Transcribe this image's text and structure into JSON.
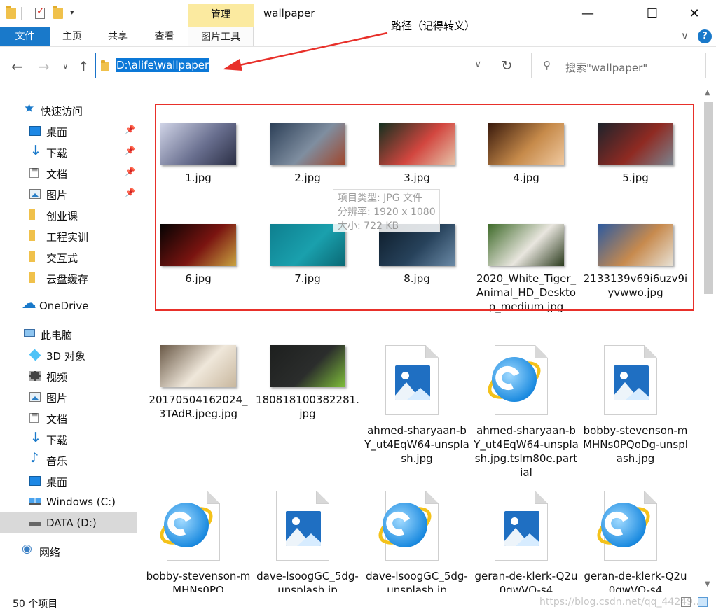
{
  "window": {
    "title": "wallpaper",
    "manage_label": "管理",
    "minimize_glyph": "—",
    "maximize_glyph": "☐",
    "close_glyph": "✕",
    "qa_dropdown_glyph": "▾",
    "accent_color": "#1979ca",
    "manage_color": "#fbeaa0"
  },
  "ribbon": {
    "tabs": [
      {
        "label": "文件"
      },
      {
        "label": "主页"
      },
      {
        "label": "共享"
      },
      {
        "label": "查看"
      },
      {
        "label": "图片工具"
      }
    ],
    "expand_glyph": "∨",
    "help_glyph": "?"
  },
  "annotation": {
    "text": "路径（记得转义）",
    "color": "#e8302a"
  },
  "navigation": {
    "back_glyph": "←",
    "forward_glyph": "→",
    "recent_glyph": "∨",
    "up_glyph": "↑",
    "address": "D:\\alife\\wallpaper",
    "address_dropdown_glyph": "∨",
    "refresh_glyph": "↻",
    "search_placeholder": "搜索\"wallpaper\"",
    "search_glyph": "⚲"
  },
  "sidebar": {
    "items": [
      {
        "label": "快速访问",
        "icon": "star-icon",
        "pinned": false
      },
      {
        "label": "桌面",
        "icon": "desktop-icon",
        "pinned": true
      },
      {
        "label": "下载",
        "icon": "download-icon",
        "pinned": true
      },
      {
        "label": "文档",
        "icon": "document-icon",
        "pinned": true
      },
      {
        "label": "图片",
        "icon": "picture-icon",
        "pinned": true
      },
      {
        "label": "创业课",
        "icon": "folder-icon",
        "pinned": false
      },
      {
        "label": "工程实训",
        "icon": "folder-icon",
        "pinned": false
      },
      {
        "label": "交互式",
        "icon": "folder-icon",
        "pinned": false
      },
      {
        "label": "云盘缓存",
        "icon": "folder-icon",
        "pinned": false
      },
      {
        "label": "OneDrive",
        "icon": "cloud-icon",
        "pinned": false
      },
      {
        "label": "此电脑",
        "icon": "computer-icon",
        "pinned": false
      },
      {
        "label": "3D 对象",
        "icon": "3d-objects-icon",
        "pinned": false
      },
      {
        "label": "视频",
        "icon": "video-icon",
        "pinned": false
      },
      {
        "label": "图片",
        "icon": "picture-icon",
        "pinned": false
      },
      {
        "label": "文档",
        "icon": "document-icon",
        "pinned": false
      },
      {
        "label": "下载",
        "icon": "download-icon",
        "pinned": false
      },
      {
        "label": "音乐",
        "icon": "music-icon",
        "pinned": false
      },
      {
        "label": "桌面",
        "icon": "desktop-icon",
        "pinned": false
      },
      {
        "label": "Windows (C:)",
        "icon": "windows-drive-icon",
        "pinned": false
      },
      {
        "label": "DATA (D:)",
        "icon": "drive-icon",
        "pinned": false,
        "selected": true
      },
      {
        "label": "网络",
        "icon": "network-icon",
        "pinned": false
      }
    ],
    "pin_glyph": "📌"
  },
  "files": [
    {
      "name": "1.jpg",
      "type": "photo",
      "palette": [
        "#cfd3e6",
        "#6a7090",
        "#2b2f45"
      ]
    },
    {
      "name": "2.jpg",
      "type": "photo",
      "palette": [
        "#2c3f57",
        "#7f8ea0",
        "#a0452a"
      ]
    },
    {
      "name": "3.jpg",
      "type": "photo",
      "palette": [
        "#14301f",
        "#d2463f",
        "#e6c3a9"
      ]
    },
    {
      "name": "4.jpg",
      "type": "photo",
      "palette": [
        "#3a1a0c",
        "#c68a4a",
        "#f0c9a0"
      ]
    },
    {
      "name": "5.jpg",
      "type": "photo",
      "palette": [
        "#1d232b",
        "#8f2a22",
        "#7b8590"
      ]
    },
    {
      "name": "6.jpg",
      "type": "photo",
      "palette": [
        "#050303",
        "#7a1410",
        "#c9a441"
      ]
    },
    {
      "name": "7.jpg",
      "type": "photo",
      "palette": [
        "#0e7f8f",
        "#1aa0ad",
        "#0a6874"
      ]
    },
    {
      "name": "8.jpg",
      "type": "photo",
      "palette": [
        "#0d1c2a",
        "#27425b",
        "#6a89a6"
      ]
    },
    {
      "name": "2020_White_Tiger_Animal_HD_Desktop_medium.jpg",
      "type": "photo",
      "palette": [
        "#3f6b2a",
        "#e9e6df",
        "#2a3a1c"
      ]
    },
    {
      "name": "2133139v69i6uzv9iyvwwo.jpg",
      "type": "photo",
      "palette": [
        "#2c5aa0",
        "#c78a4e",
        "#e8e2d6"
      ]
    },
    {
      "name": "20170504162024_3TAdR.jpeg.jpg",
      "type": "photo",
      "palette": [
        "#6b5a48",
        "#efe7da",
        "#c8b79e"
      ]
    },
    {
      "name": "180818100382281.jpg",
      "type": "photo",
      "palette": [
        "#1d1f1e",
        "#2b2d2c",
        "#7fbf3a"
      ]
    },
    {
      "name": "ahmed-sharyaan-bY_ut4EqW64-unsplash.jpg",
      "type": "image-file"
    },
    {
      "name": "ahmed-sharyaan-bY_ut4EqW64-unsplash.jpg.tslm80e.partial",
      "type": "ie-file"
    },
    {
      "name": "bobby-stevenson-mMHNs0PQoDg-unsplash.jpg",
      "type": "image-file"
    },
    {
      "name": "bobby-stevenson-mMHNs0PQ",
      "type": "ie-file"
    },
    {
      "name": "dave-lsoogGC_5dg-unsplash.jp",
      "type": "image-file"
    },
    {
      "name": "dave-lsoogGC_5dg-unsplash.jp",
      "type": "ie-file"
    },
    {
      "name": "geran-de-klerk-Q2u0qwVQ-s4",
      "type": "image-file"
    },
    {
      "name": "geran-de-klerk-Q2u0qwVQ-s4",
      "type": "ie-file"
    }
  ],
  "tooltip": {
    "lines": [
      "项目类型: JPG 文件",
      "分辨率: 1920 x 1080",
      "大小: 722 KB"
    ]
  },
  "status": {
    "count": "50 个项目",
    "watermark": "https://blog.csdn.net/qq_44249..."
  }
}
